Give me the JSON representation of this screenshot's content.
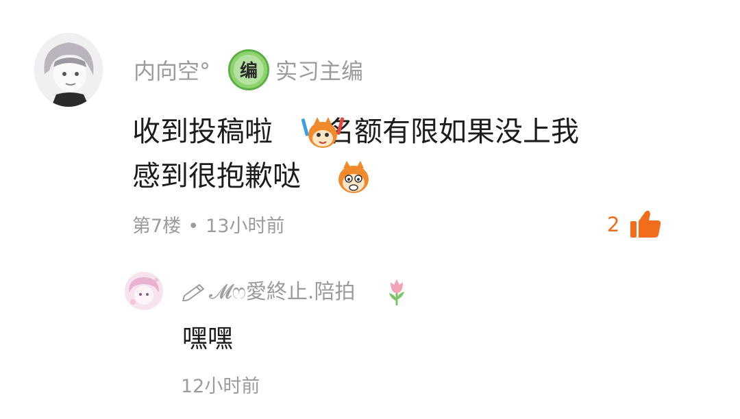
{
  "comment": {
    "username": "内向空°",
    "badge": {
      "icon": "editor-badge-icon",
      "glyph": "编",
      "label": "实习主编"
    },
    "text_line1_a": "收到投稿啦",
    "text_line1_b": "名额有限如果没上我",
    "text_line2": "感到很抱歉哒",
    "floor": "第7楼",
    "separator": "•",
    "time": "13小时前",
    "likes": "2",
    "like_icon": "thumbs-up-icon",
    "accent_color": "#f16d1c"
  },
  "reply": {
    "username": "𝓜ෆ愛終止.陪拍",
    "text": "嘿嘿",
    "time": "12小时前",
    "prefix_icon": "pencil-icon",
    "suffix_icon": "tulip-icon"
  }
}
